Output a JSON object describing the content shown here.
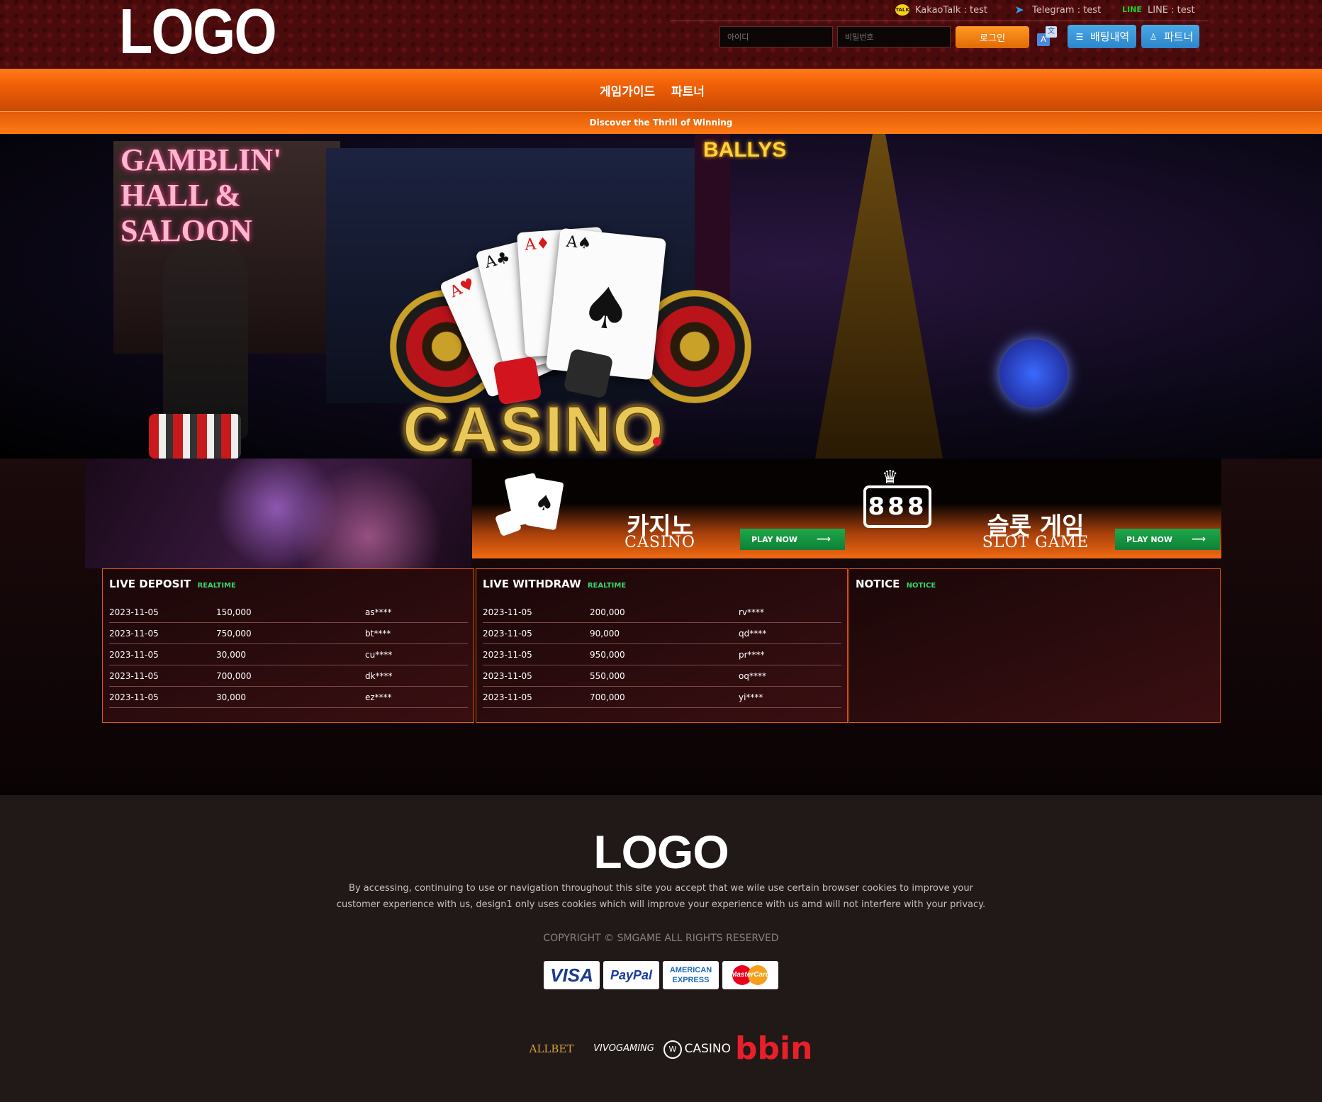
{
  "header": {
    "logo": "LOGO",
    "contacts": [
      {
        "icon": "kakaotalk-icon",
        "badge": "TALK",
        "label": "KakaoTalk : test"
      },
      {
        "icon": "telegram-icon",
        "badge": "➤",
        "label": "Telegram : test"
      },
      {
        "icon": "line-icon",
        "badge": "LINE",
        "label": "LINE : test"
      }
    ],
    "login": {
      "id_placeholder": "아이디",
      "password_placeholder": "비밀번호",
      "login_label": "로그인"
    },
    "buttons": {
      "betting_history": "배팅내역",
      "partner": "파트너"
    }
  },
  "nav": {
    "items": [
      "게임가이드",
      "파트너"
    ]
  },
  "ticker": "Discover the Thrill of Winning",
  "banner": {
    "sign_text": "GAMBLIN' HALL & SALOON",
    "bally": "BALLYS",
    "headline": "CASINO"
  },
  "games": {
    "casino": {
      "title": "카지노",
      "subtitle": "CASINO",
      "play": "PLAY NOW"
    },
    "slot": {
      "title": "슬롯 게임",
      "subtitle": "SLOT GAME",
      "play": "PLAY NOW"
    }
  },
  "panels": {
    "deposit": {
      "title": "LIVE DEPOSIT",
      "tag": "REALTIME",
      "rows": [
        [
          "2023-11-05",
          "150,000",
          "as****"
        ],
        [
          "2023-11-05",
          "750,000",
          "bt****"
        ],
        [
          "2023-11-05",
          "30,000",
          "cu****"
        ],
        [
          "2023-11-05",
          "700,000",
          "dk****"
        ],
        [
          "2023-11-05",
          "30,000",
          "ez****"
        ]
      ]
    },
    "withdraw": {
      "title": "LIVE WITHDRAW",
      "tag": "REALTIME",
      "rows": [
        [
          "2023-11-05",
          "200,000",
          "rv****"
        ],
        [
          "2023-11-05",
          "90,000",
          "qd****"
        ],
        [
          "2023-11-05",
          "950,000",
          "pr****"
        ],
        [
          "2023-11-05",
          "550,000",
          "oq****"
        ],
        [
          "2023-11-05",
          "700,000",
          "yi****"
        ]
      ]
    },
    "notice": {
      "title": "NOTICE",
      "tag": "NOTICE"
    }
  },
  "footer": {
    "logo": "LOGO",
    "text": "By accessing, continuing to use or navigation throughout this site you accept that we wile use certain browser cookies to improve your customer experience with us, design1 only uses cookies which will improve your experience with us amd will not interfere with your privacy.",
    "copyright": "COPYRIGHT © SMGAME ALL RIGHTS RESERVED",
    "payments": [
      "VISA",
      "PayPal",
      "AMERICAN EXPRESS",
      "MasterCard"
    ],
    "providers": [
      "ALLBET",
      "VIVOGAMING",
      "CASINO",
      "bbin"
    ]
  },
  "colors": {
    "header_bg": "#4a0b0d",
    "nav_orange": "#f05f06",
    "panel_border": "#e0580f",
    "realtime_green": "#39d86a",
    "play_green": "#0e8036",
    "blue_button": "#2c86cc"
  }
}
